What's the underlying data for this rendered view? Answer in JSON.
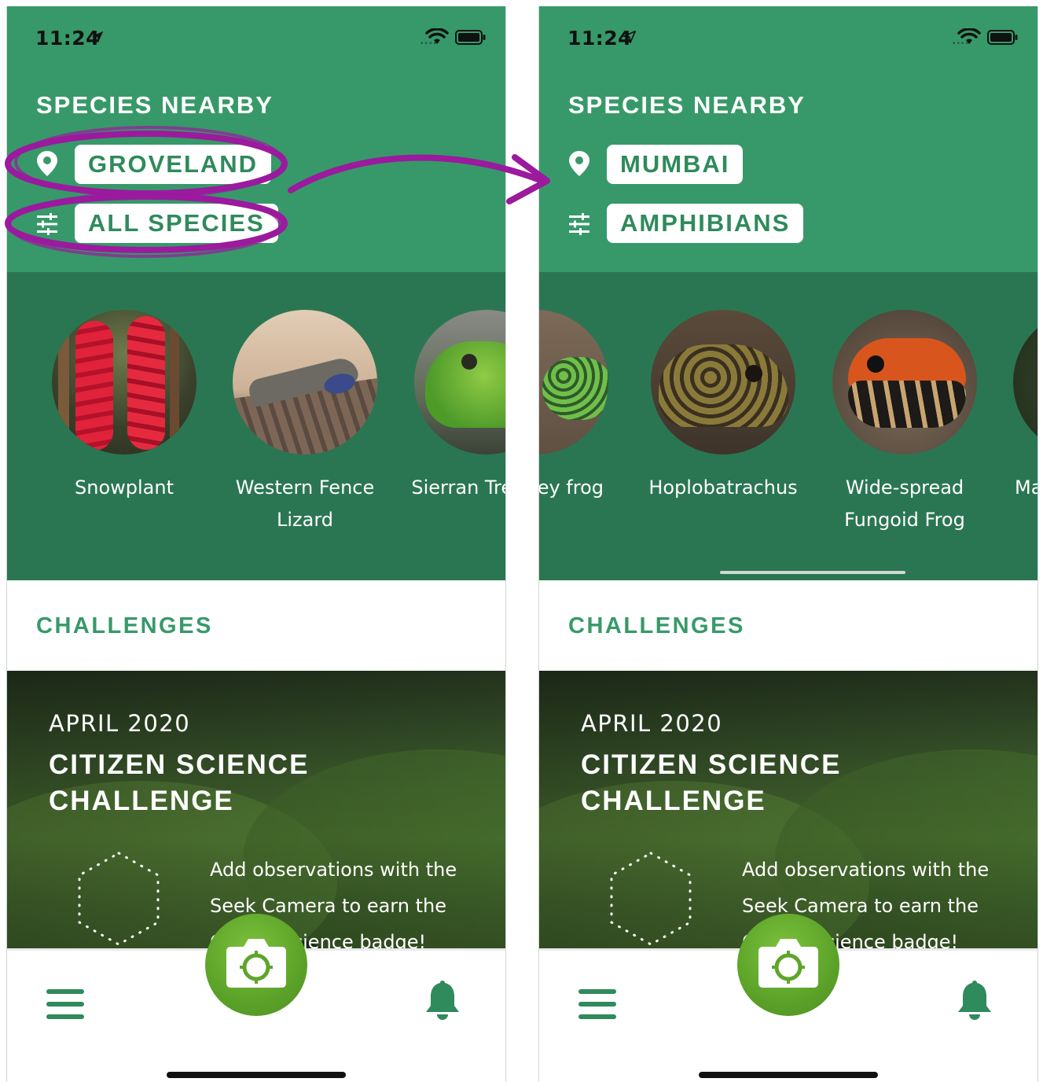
{
  "colors": {
    "header_green": "#379969",
    "carousel_green": "#2b7652",
    "accent_text": "#379969",
    "camera_button": "#5ea52a",
    "annotation_purple": "#9b1a9e"
  },
  "screens": [
    {
      "status_time": "11:24",
      "section_title": "SPECIES NEARBY",
      "location_label": "GROVELAND",
      "filter_label": "ALL SPECIES",
      "species": [
        {
          "name": "Snowplant"
        },
        {
          "name": "Western Fence Lizard"
        },
        {
          "name": "Sierran Treefrog"
        }
      ],
      "challenges_title": "CHALLENGES",
      "challenge": {
        "month": "APRIL 2020",
        "title": "CITIZEN SCIENCE CHALLENGE",
        "description": "Add observations with the Seek Camera to earn the Citizen Science badge!"
      }
    },
    {
      "status_time": "11:24",
      "section_title": "SPECIES NEARBY",
      "location_label": "MUMBAI",
      "filter_label": "AMPHIBIANS",
      "species": [
        {
          "name": "Valley frog"
        },
        {
          "name": "Hoplobatrachus"
        },
        {
          "name": "Wide-spread Fungoid Frog"
        },
        {
          "name": "Ma"
        }
      ],
      "challenges_title": "CHALLENGES",
      "challenge": {
        "month": "APRIL 2020",
        "title": "CITIZEN SCIENCE CHALLENGE",
        "description": "Add observations with the Seek Camera to earn the Citizen Science badge!"
      }
    }
  ],
  "icons": [
    "location-arrow-icon",
    "wifi-icon",
    "battery-icon",
    "map-pin-icon",
    "filter-sliders-icon",
    "menu-icon",
    "camera-icon",
    "bell-icon"
  ]
}
